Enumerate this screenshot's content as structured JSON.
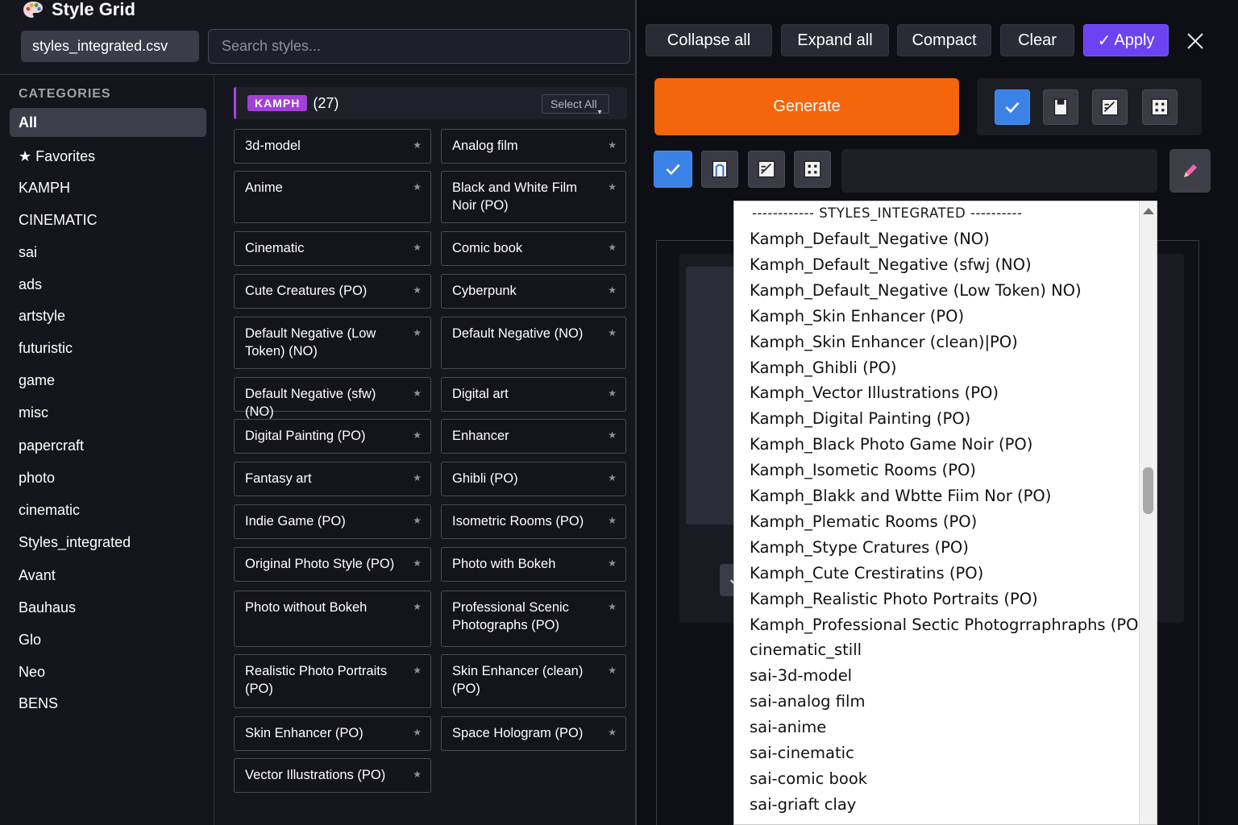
{
  "app": {
    "title": "Style Grid",
    "file_select": "styles_integrated.csv",
    "search_placeholder": "Search styles..."
  },
  "sidebar": {
    "heading": "CATEGORIES",
    "items": [
      {
        "label": "All",
        "active": true
      },
      {
        "label": "★ Favorites"
      },
      {
        "label": "KAMPH"
      },
      {
        "label": "CINEMATIC"
      },
      {
        "label": "sai"
      },
      {
        "label": "ads"
      },
      {
        "label": "artstyle"
      },
      {
        "label": "futuristic"
      },
      {
        "label": "game"
      },
      {
        "label": "misc"
      },
      {
        "label": "papercraft"
      },
      {
        "label": "photo"
      },
      {
        "label": "cinematic"
      },
      {
        "label": "Styles_integrated"
      },
      {
        "label": "Avant"
      },
      {
        "label": "Bauhaus"
      },
      {
        "label": "Glo"
      },
      {
        "label": "Neo"
      },
      {
        "label": "BENS"
      }
    ]
  },
  "group": {
    "badge": "KAMPH",
    "count": "(27)",
    "select_all": "Select All",
    "select_all_caret": "▾"
  },
  "cards": [
    {
      "label": "3d-model",
      "star": "★"
    },
    {
      "label": "Analog film",
      "star": "★"
    },
    {
      "label": "Anime",
      "star": "★"
    },
    {
      "label": "Black and White Film Noir (PO)",
      "star": "★"
    },
    {
      "label": "Cinematic",
      "star": "★"
    },
    {
      "label": "Comic book",
      "star": "★"
    },
    {
      "label": "Cute Creatures (PO)",
      "star": "★"
    },
    {
      "label": "Cyberpunk",
      "star": "★"
    },
    {
      "label": "Default Negative (Low Token) (NO)",
      "star": "★"
    },
    {
      "label": "Default Negative (NO)",
      "star": "★"
    },
    {
      "label": "Default Negative (sfw) (NO)",
      "star": "★"
    },
    {
      "label": "Digital art",
      "star": "★"
    },
    {
      "label": "Digital Painting (PO)",
      "star": "★"
    },
    {
      "label": "Enhancer",
      "star": "★"
    },
    {
      "label": "Fantasy art",
      "star": "★"
    },
    {
      "label": "Ghibli (PO)",
      "star": "★"
    },
    {
      "label": "Indie Game (PO)",
      "star": "★"
    },
    {
      "label": "Isometric Rooms (PO)",
      "star": "★"
    },
    {
      "label": "Original Photo Style (PO)",
      "star": "★"
    },
    {
      "label": "Photo with Bokeh",
      "star": "★"
    },
    {
      "label": "Photo without Bokeh",
      "star": "★"
    },
    {
      "label": "Professional Scenic Photographs (PO)",
      "star": "★"
    },
    {
      "label": "Realistic Photo Portraits (PO)",
      "star": "★"
    },
    {
      "label": "Skin Enhancer (clean)(PO)",
      "star": "★"
    },
    {
      "label": "Skin Enhancer (PO)",
      "star": "★"
    },
    {
      "label": "Space Hologram (PO)",
      "star": "★"
    },
    {
      "label": "Vector Illustrations (PO)",
      "star": "★"
    }
  ],
  "toolbar": {
    "collapse_all": "Collapse all",
    "expand_all": "Expand all",
    "compact": "Compact",
    "clear": "Clear",
    "apply": "Apply",
    "apply_icon": "✓",
    "close_icon": "close-icon"
  },
  "generate": {
    "label": "Generate",
    "color": "#f4650c"
  },
  "dropdown": {
    "header": "------------  STYLES_INTEGRATED  ----------",
    "options": [
      "Kamph_Default_Negative (NO)",
      "Kamph_Default_Negative (sfwj (NO)",
      "Kamph_Default_Negative (Low Token) NO)",
      "Kamph_Skin Enhancer (PO)",
      "Kamph_Skin Enhancer (clean)|PO)",
      "Kamph_Ghibli (PO)",
      "Kamph_Vector Illustrations (PO)",
      "Kamph_Digital Painting (PO)",
      "Kamph_Black Photo Game Noir (PO)",
      "Kamph_Isometic Rooms (PO)",
      "Kamph_Blakk and Wbtte Fiim Nor (PO)",
      "Kamph_Plematic Rooms (PO)",
      "Kamph_Stype Cratures (PO)",
      "Kamph_Cute Crestiratins (PO)",
      "Kamph_Realistic Photo Portraits (PO)",
      "Kamph_Professional Sectic Photogrraphraphs (PO)",
      "cinematic_still",
      "sai-3d-model",
      "sai-analog film",
      "sai-anime",
      "sai-cinematic",
      "sai-comic book",
      "sai-griaft clay"
    ]
  },
  "colors": {
    "accent_purple": "#a23fd8",
    "apply_violet": "#6b43f2",
    "checkbox_blue": "#3b82e6"
  }
}
